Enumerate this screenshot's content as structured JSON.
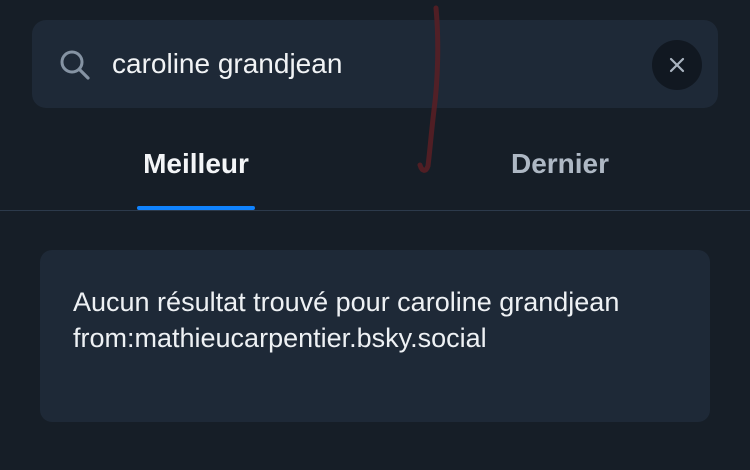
{
  "search": {
    "query": "caroline grandjean",
    "placeholder": ""
  },
  "tabs": [
    {
      "label": "Meilleur",
      "selected": true
    },
    {
      "label": "Dernier",
      "selected": false
    }
  ],
  "result": {
    "message": "Aucun résultat trouvé pour caroline grandjean from:mathieucarpentier.bsky.social"
  },
  "colors": {
    "background": "#161e27",
    "surface": "#1e2937",
    "accent": "#1083fe",
    "text": "#f1f3f5",
    "muted": "#aeb8c4",
    "mark": "#5a1e24"
  },
  "icons": {
    "search": "search-icon",
    "clear": "close-icon"
  }
}
